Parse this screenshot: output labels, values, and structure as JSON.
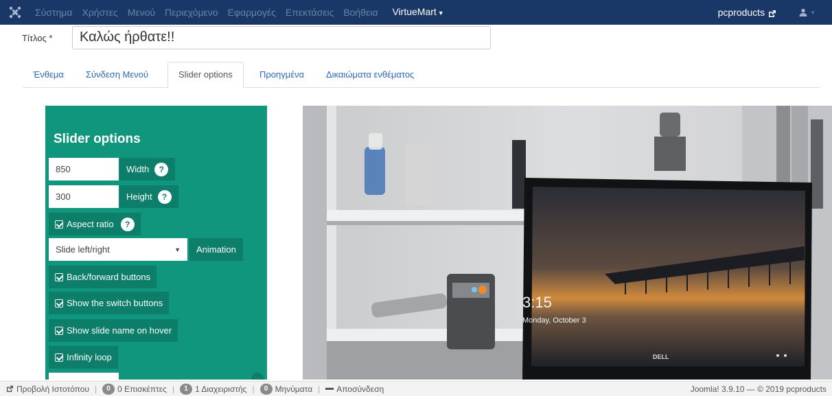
{
  "navbar": {
    "menu": [
      "Σύστημα",
      "Χρήστες",
      "Μενού",
      "Περιεχόμενο",
      "Εφαρμογές",
      "Επεκτάσεις",
      "Βοήθεια"
    ],
    "virtuemart": "VirtueMart",
    "site_name": "pcproducts"
  },
  "title": {
    "label": "Τίτλος *",
    "value": "Καλώς ήρθατε!!"
  },
  "tabs": [
    "Ένθεμα",
    "Σύνδεση Μενού",
    "Slider options",
    "Προηγμένα",
    "Δικαιώματα ενθέματος"
  ],
  "active_tab": "Slider options",
  "panel": {
    "title": "Slider options",
    "width_value": "850",
    "width_label": "Width",
    "height_value": "300",
    "height_label": "Height",
    "aspect_ratio": "Aspect ratio",
    "animation_selected": "Slide left/right",
    "animation_label": "Animation",
    "back_forward": "Back/forward buttons",
    "switch_buttons": "Show the switch buttons",
    "slide_name_hover": "Show slide name on hover",
    "infinity_loop": "Infinity loop",
    "help": "?"
  },
  "preview": {
    "clock_time": "3:15",
    "clock_date": "Monday, October 3",
    "laptop_brand": "DELL"
  },
  "statusbar": {
    "view_site": "Προβολή Ιστοτόπου",
    "visitors_count": "0",
    "visitors_label": "0 Επισκέπτες",
    "admins_count": "1",
    "admins_label": "1 Διαχειριστής",
    "messages_count": "0",
    "messages_label": "Μηνύματα",
    "logout": "Αποσύνδεση",
    "version": "Joomla! 3.9.10 — © 2019 pcproducts"
  },
  "colors": {
    "navbar": "#1a3867",
    "panel": "#0f967d",
    "panel_dark": "#0c7e69",
    "link": "#2a69b8"
  }
}
